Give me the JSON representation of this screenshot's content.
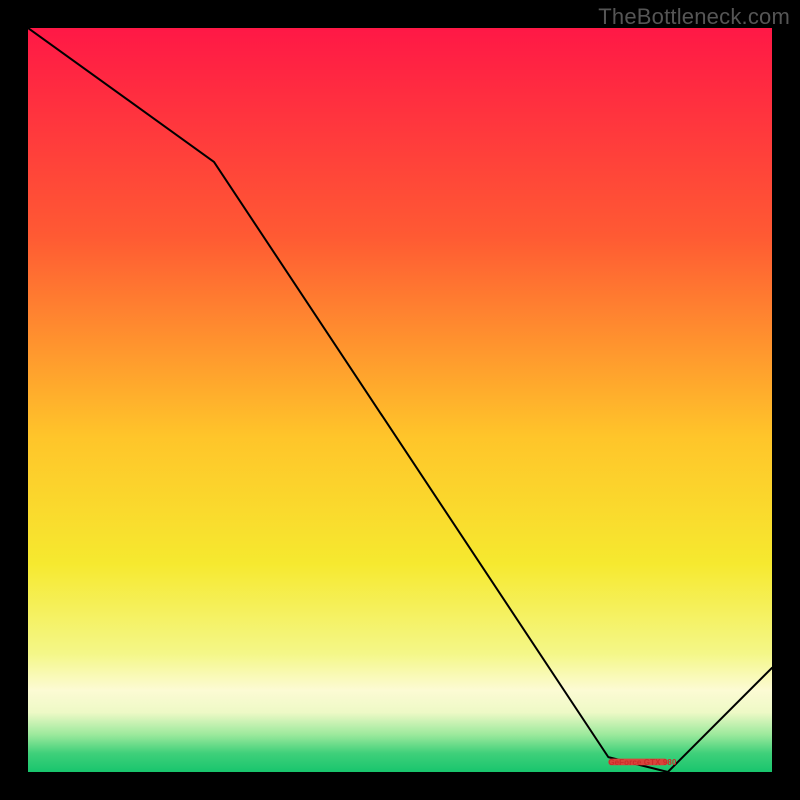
{
  "watermark": "TheBottleneck.com",
  "marker_label": "GeForce GTX 980",
  "chart_data": {
    "type": "line",
    "x": [
      0,
      25,
      78,
      86,
      100
    ],
    "values": [
      100,
      82,
      2,
      0,
      14
    ],
    "title": "",
    "xlabel": "",
    "ylabel": "",
    "xlim": [
      0,
      100
    ],
    "ylim": [
      0,
      100
    ],
    "marker": {
      "x_start": 78,
      "x_end": 86,
      "y": 1.2,
      "color": "#d9443a",
      "label": "GeForce GTX 980"
    },
    "gradient_stops": [
      {
        "offset": 0.0,
        "color": "#ff1846"
      },
      {
        "offset": 0.28,
        "color": "#ff5a33"
      },
      {
        "offset": 0.55,
        "color": "#ffc52a"
      },
      {
        "offset": 0.72,
        "color": "#f6e92f"
      },
      {
        "offset": 0.84,
        "color": "#f4f787"
      },
      {
        "offset": 0.89,
        "color": "#fcfbd4"
      },
      {
        "offset": 0.92,
        "color": "#eef9c6"
      },
      {
        "offset": 0.95,
        "color": "#9be99c"
      },
      {
        "offset": 0.975,
        "color": "#3fd07a"
      },
      {
        "offset": 1.0,
        "color": "#18c56d"
      }
    ]
  }
}
